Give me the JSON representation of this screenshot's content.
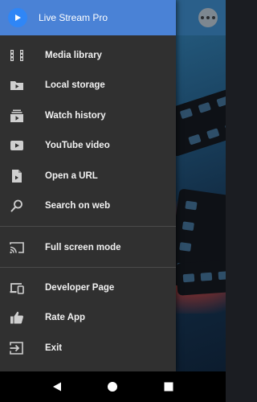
{
  "app": {
    "title": "Live Stream Pro",
    "accent": "#4a82d6"
  },
  "menu": {
    "items": [
      {
        "label": "Media library",
        "icon": "film-icon"
      },
      {
        "label": "Local storage",
        "icon": "folder-icon"
      },
      {
        "label": "Watch history",
        "icon": "history-icon"
      },
      {
        "label": "YouTube video",
        "icon": "youtube-icon"
      },
      {
        "label": "Open a URL",
        "icon": "file-icon"
      },
      {
        "label": "Search on web",
        "icon": "search-icon"
      }
    ],
    "items2": [
      {
        "label": "Full screen mode",
        "icon": "cast-icon"
      }
    ],
    "items3": [
      {
        "label": "Developer Page",
        "icon": "devices-icon"
      },
      {
        "label": "Rate App",
        "icon": "thumbs-up-icon"
      },
      {
        "label": "Exit",
        "icon": "exit-icon"
      }
    ]
  },
  "navbar": {
    "buttons": [
      "back-icon",
      "home-icon",
      "recents-icon"
    ]
  }
}
